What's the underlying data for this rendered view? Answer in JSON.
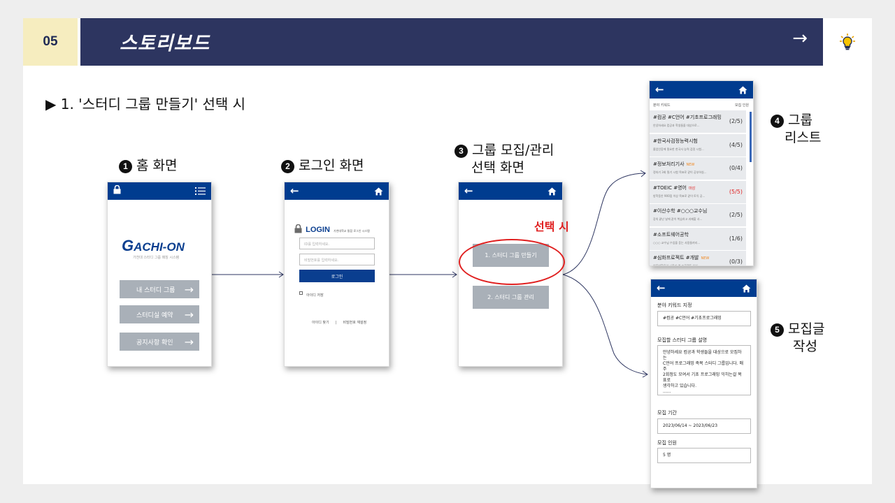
{
  "header": {
    "number": "05",
    "title": "스토리보드",
    "next_arrow": "→",
    "bulb_icon": "light-bulb-icon"
  },
  "subtitle": "▶ 1. '스터디 그룹 만들기' 선택 시",
  "steps": {
    "s1": {
      "num": "1",
      "label": "홈 화면"
    },
    "s2": {
      "num": "2",
      "label": "로그인 화면"
    },
    "s3": {
      "num": "3",
      "label_line1": "그룹 모집/관리",
      "label_line2": "선택 화면"
    },
    "s4": {
      "num": "4",
      "label_line1": "그룹",
      "label_line2": "리스트"
    },
    "s5": {
      "num": "5",
      "label_line1": "모집글",
      "label_line2": "작성"
    }
  },
  "home": {
    "logo_g": "G",
    "logo_rest": "ACHI-ON",
    "tagline": "가천대 스터디 그룹 매칭 시스템",
    "buttons": [
      "내 스터디 그룹",
      "스터디실 예약",
      "공지사항 확인"
    ]
  },
  "login": {
    "title": "LOGIN",
    "caption": "가천대학교 통합 로그인 시스템",
    "id_placeholder": "ID를 입력하세요.",
    "pw_placeholder": "비밀번호를 입력하세요.",
    "login_button": "로그인",
    "save_id": "아이디 저장",
    "find_id": "아이디 찾기",
    "divider": "|",
    "find_pw": "비밀번호 재설정"
  },
  "select": {
    "highlight": "선택 시",
    "highlight_color": "#e02020",
    "option1": "1. 스터디 그룹 만들기",
    "option2": "2. 스터디 그룹 관리"
  },
  "group_list": {
    "col_keyword": "분야 키워드",
    "col_members": "모집 인원",
    "rows": [
      {
        "keyword": "#컴공 #C언어 #기초프로그래밍",
        "badge": "",
        "desc": "안녕하세요 컴공과 학생들을 대상으로...",
        "count": "(2/5)",
        "full": false
      },
      {
        "keyword": "#한국사검정능력시험",
        "badge": "",
        "desc": "졸업인증에 필요한 한국사 능력 검정 시험...",
        "count": "(4/5)",
        "full": false
      },
      {
        "keyword": "#정보처리기사",
        "badge": "NEW",
        "desc": "정처기 3회 필기 시험 목표로 같이 공부하실...",
        "count": "(0/4)",
        "full": false
      },
      {
        "keyword": "#TOEIC #영어",
        "badge": "마감",
        "desc": "방학동안 900점 이상 목표로 같이 토익 공...",
        "count": "(5/5)",
        "full": true
      },
      {
        "keyword": "#이산수학 #○○○교수님",
        "badge": "",
        "desc": "강의 끝난 날에 같이 복습하고 과제할 사...",
        "count": "(2/5)",
        "full": false
      },
      {
        "keyword": "#소프트웨어공학",
        "badge": "",
        "desc": "○○○ 교수님 수업을 듣는 사람들끼리...",
        "count": "(1/6)",
        "full": false
      },
      {
        "keyword": "#심화프로젝트 #개발",
        "badge": "NEW",
        "desc": "여름방학동안 사용자 앱 프로젝트 하실...",
        "count": "(0/3)",
        "full": false
      }
    ]
  },
  "write": {
    "keyword_label": "분야 키워드 지정",
    "keyword_value": "#컴공 #C언어 #기초프로그래밍",
    "desc_label": "모집할 스터디 그룹 설명",
    "desc_lines": [
      "안녕하세요 컴공과 학생들을 대상으로 모집하는",
      "C언어 프로그래밍 족목 스터디 그룹입니다. 매주",
      "2회정도 모여서 기초 프로그래밍 익히는걸 목표로",
      "생각하고 있습니다.",
      "......"
    ],
    "period_label": "모집 기간",
    "period_value": "2023/06/14 ~ 2023/06/23",
    "members_label": "모집 인원",
    "members_value": "5 명"
  }
}
